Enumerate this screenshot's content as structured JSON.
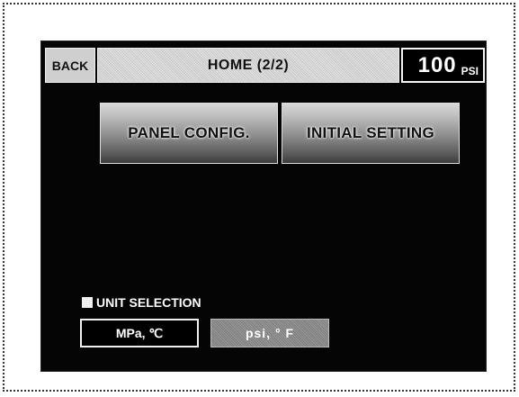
{
  "header": {
    "back_label": "BACK",
    "title": "HOME (2/2)",
    "pressure_value": "100",
    "pressure_unit": "PSI"
  },
  "menu": {
    "buttons": [
      {
        "label": "PANEL CONFIG."
      },
      {
        "label": "INITIAL SETTING"
      }
    ]
  },
  "unit_selection": {
    "label": "UNIT SELECTION",
    "options": [
      {
        "label": "MPa, ℃",
        "selected": false
      },
      {
        "label": "psi, ° F",
        "selected": true
      }
    ]
  },
  "colors": {
    "screen_background": "#050505",
    "selected_option": "#8a8a8a"
  }
}
